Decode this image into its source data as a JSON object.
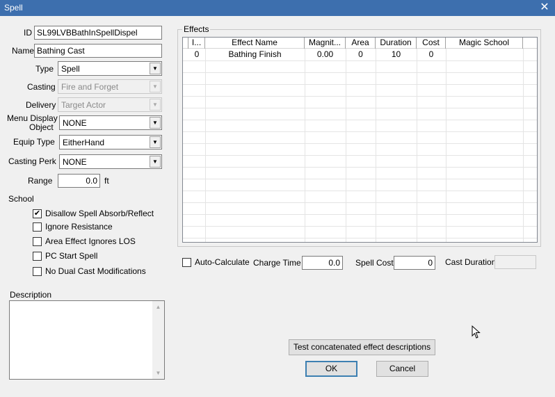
{
  "window": {
    "title": "Spell",
    "close_glyph": "✕"
  },
  "form": {
    "id_label": "ID",
    "id_value": "SL99LVBBathInSpellDispel",
    "name_label": "Name",
    "name_value": "Bathing Cast",
    "type_label": "Type",
    "type_value": "Spell",
    "casting_label": "Casting",
    "casting_value": "Fire and Forget",
    "delivery_label": "Delivery",
    "delivery_value": "Target Actor",
    "menu_display_label_1": "Menu Display",
    "menu_display_label_2": "Object",
    "menu_display_value": "NONE",
    "equip_type_label": "Equip Type",
    "equip_type_value": "EitherHand",
    "casting_perk_label": "Casting Perk",
    "casting_perk_value": "NONE",
    "range_label": "Range",
    "range_value": "0.0",
    "range_unit": "ft",
    "school_label": "School",
    "checkboxes": [
      {
        "label": "Disallow Spell Absorb/Reflect",
        "checked": true
      },
      {
        "label": "Ignore Resistance",
        "checked": false
      },
      {
        "label": "Area Effect Ignores LOS",
        "checked": false
      },
      {
        "label": "PC Start Spell",
        "checked": false
      },
      {
        "label": "No Dual Cast Modifications",
        "checked": false
      }
    ],
    "description_label": "Description",
    "description_value": ""
  },
  "effects": {
    "group_title": "Effects",
    "columns": [
      "I...",
      "Effect Name",
      "Magnit...",
      "Area",
      "Duration",
      "Cost",
      "Magic School"
    ],
    "rows": [
      [
        "0",
        "Bathing Finish",
        "0.00",
        "0",
        "10",
        "0",
        ""
      ]
    ]
  },
  "costs": {
    "auto_calculate_label": "Auto-Calculate",
    "auto_calculate_checked": false,
    "charge_time_label": "Charge Time",
    "charge_time_value": "0.0",
    "spell_cost_label": "Spell Cost",
    "spell_cost_value": "0",
    "cast_duration_label": "Cast Duration",
    "cast_duration_value": ""
  },
  "buttons": {
    "test_descriptions": "Test concatenated effect descriptions",
    "ok": "OK",
    "cancel": "Cancel"
  },
  "icons": {
    "combo_arrow": "▼",
    "check_mark": "✔",
    "scroll_up": "▲",
    "scroll_down": "▼"
  }
}
